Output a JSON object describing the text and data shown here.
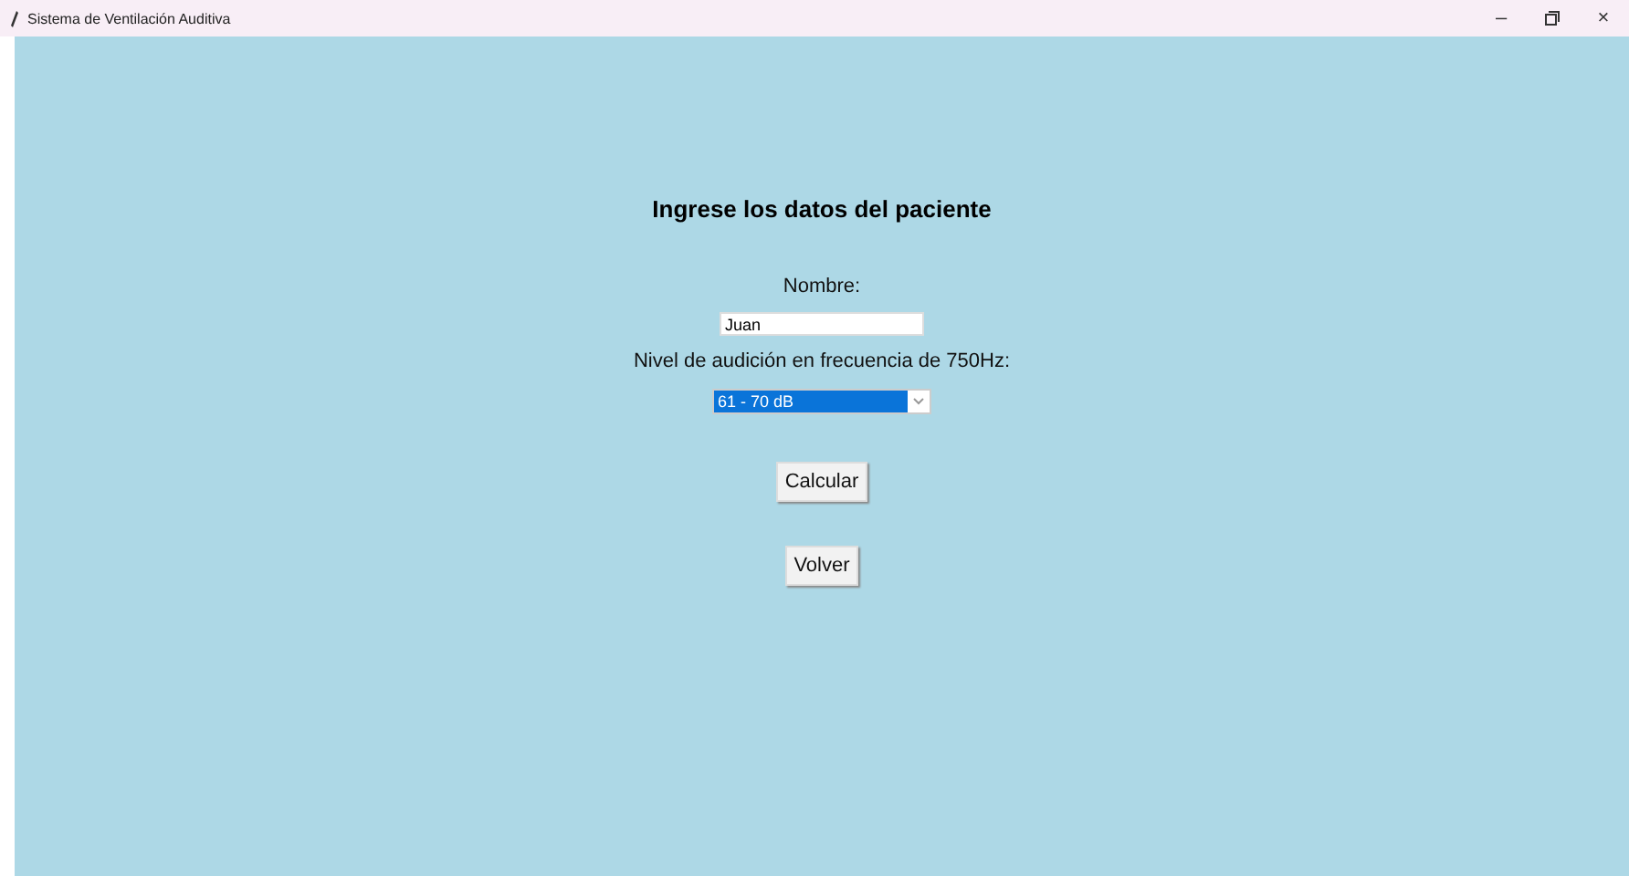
{
  "window": {
    "title": "Sistema de Ventilación Auditiva",
    "controls": [
      "–",
      "×"
    ]
  },
  "form": {
    "heading": "Ingrese los datos del paciente",
    "name_label": "Nombre:",
    "name_value": "Juan",
    "level_label": "Nivel de audición en frecuencia de 750Hz:",
    "level_value": "61 - 70 dB",
    "buttons": [
      "Calcular",
      "Volver"
    ]
  }
}
